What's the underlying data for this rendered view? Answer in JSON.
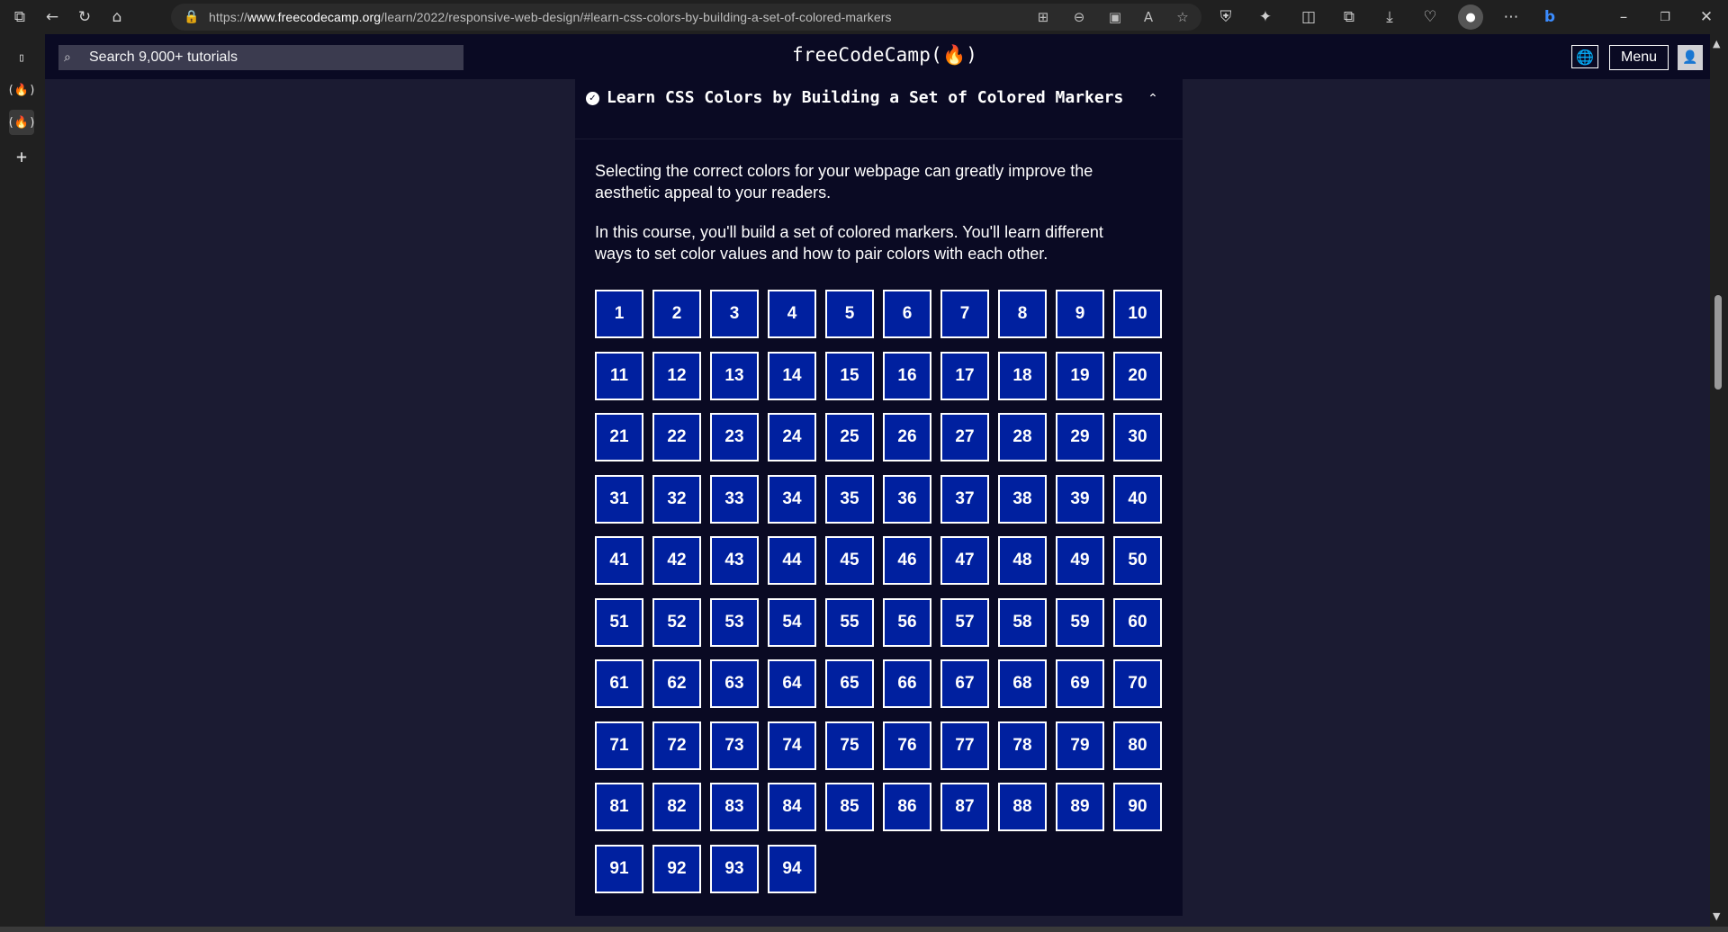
{
  "browser": {
    "url_prefix": "https://",
    "url_domain": "www.freecodecamp.org",
    "url_path": "/learn/2022/responsive-web-design/#learn-css-colors-by-building-a-set-of-colored-markers"
  },
  "nav": {
    "search_placeholder": "Search 9,000+ tutorials",
    "logo": "freeCodeCamp(🔥)",
    "menu_label": "Menu"
  },
  "block": {
    "title": "Learn CSS Colors by Building a Set of Colored Markers",
    "intro_1": "Selecting the correct colors for your webpage can greatly improve the aesthetic appeal to your readers.",
    "intro_2": "In this course, you'll build a set of colored markers. You'll learn different ways to set color values and how to pair colors with each other.",
    "steps": [
      "1",
      "2",
      "3",
      "4",
      "5",
      "6",
      "7",
      "8",
      "9",
      "10",
      "11",
      "12",
      "13",
      "14",
      "15",
      "16",
      "17",
      "18",
      "19",
      "20",
      "21",
      "22",
      "23",
      "24",
      "25",
      "26",
      "27",
      "28",
      "29",
      "30",
      "31",
      "32",
      "33",
      "34",
      "35",
      "36",
      "37",
      "38",
      "39",
      "40",
      "41",
      "42",
      "43",
      "44",
      "45",
      "46",
      "47",
      "48",
      "49",
      "50",
      "51",
      "52",
      "53",
      "54",
      "55",
      "56",
      "57",
      "58",
      "59",
      "60",
      "61",
      "62",
      "63",
      "64",
      "65",
      "66",
      "67",
      "68",
      "69",
      "70",
      "71",
      "72",
      "73",
      "74",
      "75",
      "76",
      "77",
      "78",
      "79",
      "80",
      "81",
      "82",
      "83",
      "84",
      "85",
      "86",
      "87",
      "88",
      "89",
      "90",
      "91",
      "92",
      "93",
      "94"
    ]
  },
  "colors": {
    "page_bg": "#1b1b32",
    "panel_bg": "#0a0a23",
    "step_bg": "#00209f"
  }
}
